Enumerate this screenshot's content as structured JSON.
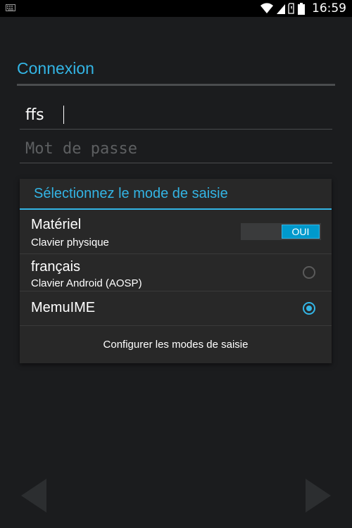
{
  "status_bar": {
    "time": "16:59",
    "icons": [
      "keyboard-icon",
      "wifi-icon",
      "signal-icon",
      "sim-icon",
      "battery-icon"
    ]
  },
  "login": {
    "title": "Connexion",
    "username_value": "ffs",
    "password_placeholder": "Mot de passe"
  },
  "dialog": {
    "title": "Sélectionnez le mode de saisie",
    "options": [
      {
        "title": "Matériel",
        "subtitle": "Clavier physique",
        "toggle_label": "OUI"
      },
      {
        "title": "français",
        "subtitle": "Clavier Android (AOSP)",
        "selected": false
      },
      {
        "title": "MemuIME",
        "selected": true
      }
    ],
    "configure_label": "Configurer les modes de saisie"
  },
  "nav": {
    "prev_icon": "chevron-left-icon",
    "next_icon": "chevron-right-icon"
  },
  "colors": {
    "accent": "#33b5e5",
    "background": "#1b1c1e",
    "dialog_bg": "#282828"
  }
}
